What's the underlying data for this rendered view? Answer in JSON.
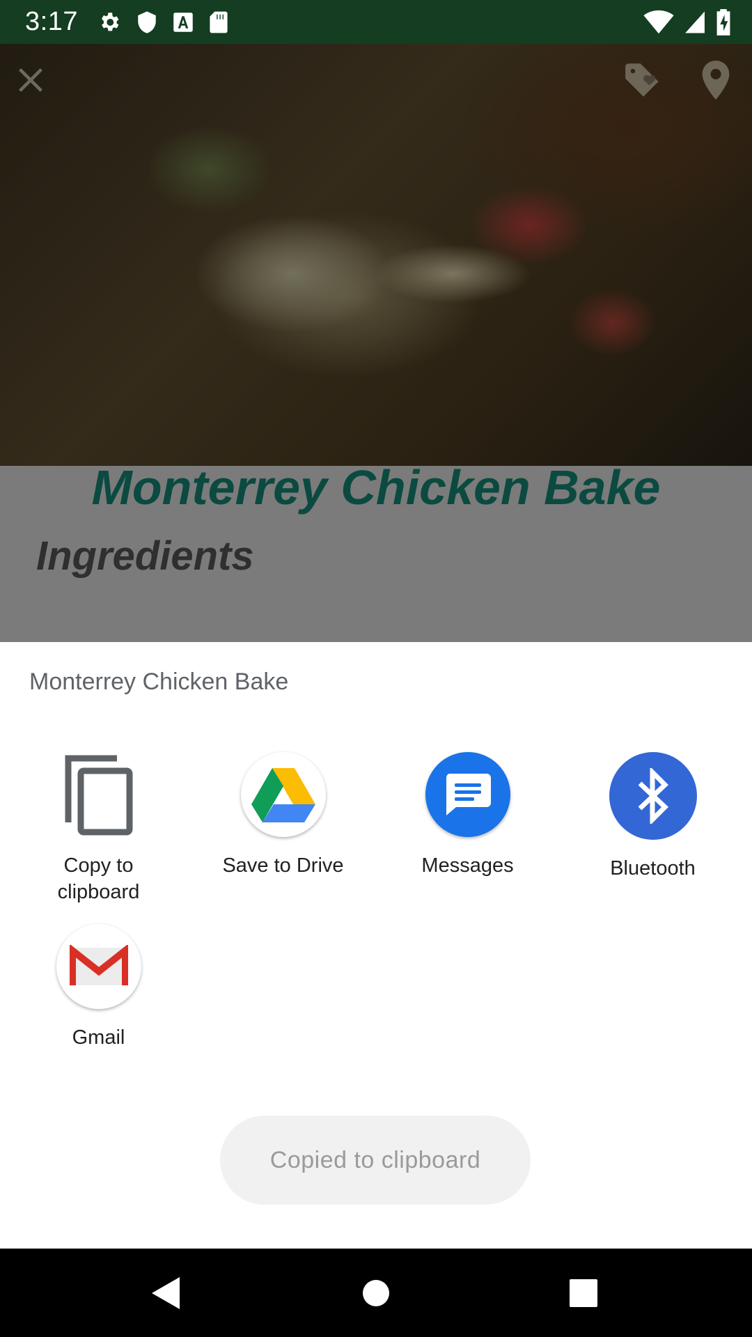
{
  "status_bar": {
    "time": "3:17",
    "left_icons": [
      "gear-icon",
      "shield-icon",
      "font-a-icon",
      "sd-card-icon"
    ],
    "right_icons": [
      "wifi-icon",
      "cell-signal-icon",
      "battery-charging-icon"
    ],
    "background_color": "#143d22"
  },
  "recipe": {
    "title": "Monterrey Chicken Bake",
    "section_heading": "Ingredients",
    "title_color": "#0b4a40",
    "toolbar_icons": [
      "close-icon",
      "tag-heart-icon",
      "location-pin-icon"
    ]
  },
  "share_sheet": {
    "title": "Monterrey Chicken Bake",
    "targets": [
      {
        "label": "Copy to clipboard",
        "icon": "copy-icon"
      },
      {
        "label": "Save to Drive",
        "icon": "google-drive-icon"
      },
      {
        "label": "Messages",
        "icon": "messages-icon",
        "color": "#1a73e8"
      },
      {
        "label": "Bluetooth",
        "icon": "bluetooth-icon",
        "color": "#3367d6"
      },
      {
        "label": "Gmail",
        "icon": "gmail-icon",
        "color": "#d93025"
      }
    ],
    "toast": "Copied to clipboard"
  },
  "nav_bar": {
    "buttons": [
      "back-icon",
      "home-icon",
      "recents-icon"
    ]
  }
}
